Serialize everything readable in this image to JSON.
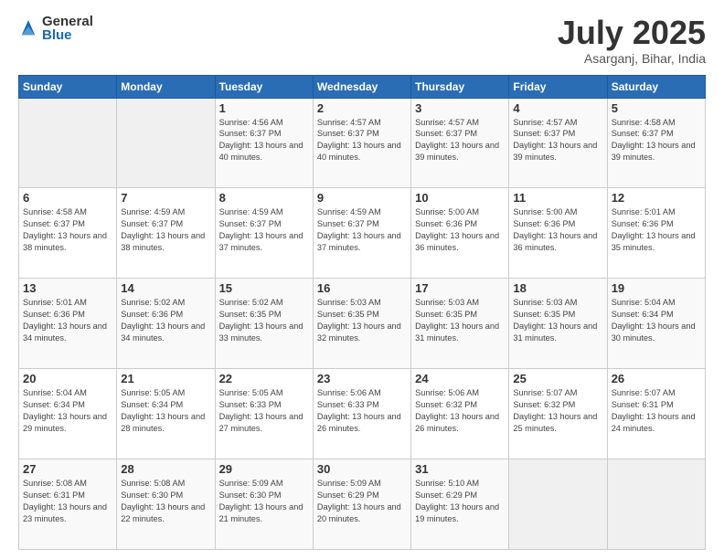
{
  "logo": {
    "general": "General",
    "blue": "Blue"
  },
  "header": {
    "title": "July 2025",
    "location": "Asarganj, Bihar, India"
  },
  "days": [
    "Sunday",
    "Monday",
    "Tuesday",
    "Wednesday",
    "Thursday",
    "Friday",
    "Saturday"
  ],
  "weeks": [
    [
      {
        "day": "",
        "info": ""
      },
      {
        "day": "",
        "info": ""
      },
      {
        "day": "1",
        "info": "Sunrise: 4:56 AM\nSunset: 6:37 PM\nDaylight: 13 hours\nand 40 minutes."
      },
      {
        "day": "2",
        "info": "Sunrise: 4:57 AM\nSunset: 6:37 PM\nDaylight: 13 hours\nand 40 minutes."
      },
      {
        "day": "3",
        "info": "Sunrise: 4:57 AM\nSunset: 6:37 PM\nDaylight: 13 hours\nand 39 minutes."
      },
      {
        "day": "4",
        "info": "Sunrise: 4:57 AM\nSunset: 6:37 PM\nDaylight: 13 hours\nand 39 minutes."
      },
      {
        "day": "5",
        "info": "Sunrise: 4:58 AM\nSunset: 6:37 PM\nDaylight: 13 hours\nand 39 minutes."
      }
    ],
    [
      {
        "day": "6",
        "info": "Sunrise: 4:58 AM\nSunset: 6:37 PM\nDaylight: 13 hours\nand 38 minutes."
      },
      {
        "day": "7",
        "info": "Sunrise: 4:59 AM\nSunset: 6:37 PM\nDaylight: 13 hours\nand 38 minutes."
      },
      {
        "day": "8",
        "info": "Sunrise: 4:59 AM\nSunset: 6:37 PM\nDaylight: 13 hours\nand 37 minutes."
      },
      {
        "day": "9",
        "info": "Sunrise: 4:59 AM\nSunset: 6:37 PM\nDaylight: 13 hours\nand 37 minutes."
      },
      {
        "day": "10",
        "info": "Sunrise: 5:00 AM\nSunset: 6:36 PM\nDaylight: 13 hours\nand 36 minutes."
      },
      {
        "day": "11",
        "info": "Sunrise: 5:00 AM\nSunset: 6:36 PM\nDaylight: 13 hours\nand 36 minutes."
      },
      {
        "day": "12",
        "info": "Sunrise: 5:01 AM\nSunset: 6:36 PM\nDaylight: 13 hours\nand 35 minutes."
      }
    ],
    [
      {
        "day": "13",
        "info": "Sunrise: 5:01 AM\nSunset: 6:36 PM\nDaylight: 13 hours\nand 34 minutes."
      },
      {
        "day": "14",
        "info": "Sunrise: 5:02 AM\nSunset: 6:36 PM\nDaylight: 13 hours\nand 34 minutes."
      },
      {
        "day": "15",
        "info": "Sunrise: 5:02 AM\nSunset: 6:35 PM\nDaylight: 13 hours\nand 33 minutes."
      },
      {
        "day": "16",
        "info": "Sunrise: 5:03 AM\nSunset: 6:35 PM\nDaylight: 13 hours\nand 32 minutes."
      },
      {
        "day": "17",
        "info": "Sunrise: 5:03 AM\nSunset: 6:35 PM\nDaylight: 13 hours\nand 31 minutes."
      },
      {
        "day": "18",
        "info": "Sunrise: 5:03 AM\nSunset: 6:35 PM\nDaylight: 13 hours\nand 31 minutes."
      },
      {
        "day": "19",
        "info": "Sunrise: 5:04 AM\nSunset: 6:34 PM\nDaylight: 13 hours\nand 30 minutes."
      }
    ],
    [
      {
        "day": "20",
        "info": "Sunrise: 5:04 AM\nSunset: 6:34 PM\nDaylight: 13 hours\nand 29 minutes."
      },
      {
        "day": "21",
        "info": "Sunrise: 5:05 AM\nSunset: 6:34 PM\nDaylight: 13 hours\nand 28 minutes."
      },
      {
        "day": "22",
        "info": "Sunrise: 5:05 AM\nSunset: 6:33 PM\nDaylight: 13 hours\nand 27 minutes."
      },
      {
        "day": "23",
        "info": "Sunrise: 5:06 AM\nSunset: 6:33 PM\nDaylight: 13 hours\nand 26 minutes."
      },
      {
        "day": "24",
        "info": "Sunrise: 5:06 AM\nSunset: 6:32 PM\nDaylight: 13 hours\nand 26 minutes."
      },
      {
        "day": "25",
        "info": "Sunrise: 5:07 AM\nSunset: 6:32 PM\nDaylight: 13 hours\nand 25 minutes."
      },
      {
        "day": "26",
        "info": "Sunrise: 5:07 AM\nSunset: 6:31 PM\nDaylight: 13 hours\nand 24 minutes."
      }
    ],
    [
      {
        "day": "27",
        "info": "Sunrise: 5:08 AM\nSunset: 6:31 PM\nDaylight: 13 hours\nand 23 minutes."
      },
      {
        "day": "28",
        "info": "Sunrise: 5:08 AM\nSunset: 6:30 PM\nDaylight: 13 hours\nand 22 minutes."
      },
      {
        "day": "29",
        "info": "Sunrise: 5:09 AM\nSunset: 6:30 PM\nDaylight: 13 hours\nand 21 minutes."
      },
      {
        "day": "30",
        "info": "Sunrise: 5:09 AM\nSunset: 6:29 PM\nDaylight: 13 hours\nand 20 minutes."
      },
      {
        "day": "31",
        "info": "Sunrise: 5:10 AM\nSunset: 6:29 PM\nDaylight: 13 hours\nand 19 minutes."
      },
      {
        "day": "",
        "info": ""
      },
      {
        "day": "",
        "info": ""
      }
    ]
  ]
}
